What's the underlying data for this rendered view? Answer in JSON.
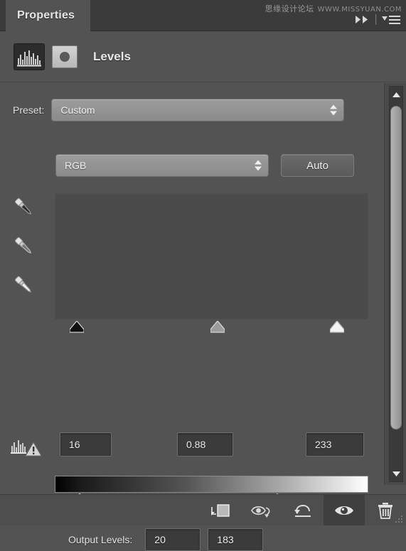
{
  "window": {
    "tab_label": "Properties",
    "watermark_cn": "思缘设计论坛",
    "watermark_url": "WWW.MISSYUAN.COM",
    "collapse_icon": "double-chevron-right-icon",
    "menu_icon": "panel-menu-icon"
  },
  "adjustment": {
    "title": "Levels",
    "type_icon": "levels-histogram-icon",
    "mask_icon": "layer-mask-thumbnail"
  },
  "preset": {
    "label": "Preset:",
    "value": "Custom",
    "stepper_icon": "stepper-arrows-icon"
  },
  "channel": {
    "value": "RGB",
    "stepper_icon": "stepper-arrows-icon",
    "auto_label": "Auto"
  },
  "eyedroppers": [
    {
      "name": "set-black-point-eyedropper",
      "tip": "black"
    },
    {
      "name": "set-gray-point-eyedropper",
      "tip": "gray"
    },
    {
      "name": "set-white-point-eyedropper",
      "tip": "white"
    }
  ],
  "input_levels": {
    "shadow": "16",
    "midtone": "0.88",
    "highlight": "233",
    "warning_icon": "histogram-refresh-warning-icon",
    "slider_positions_pct": {
      "shadow": 7,
      "midtone": 52,
      "highlight": 90
    }
  },
  "output_levels": {
    "label": "Output Levels:",
    "black": "20",
    "white": "183",
    "slider_positions_pct": {
      "black": 8,
      "white": 71
    }
  },
  "scrollbar": {
    "up_icon": "scroll-up-arrow-icon",
    "down_icon": "scroll-down-arrow-icon",
    "thumb": "scrollbar-thumb"
  },
  "toolbar": [
    {
      "name": "clip-to-layer-button",
      "icon": "clip-to-layer-icon",
      "active": false
    },
    {
      "name": "toggle-previous-state-button",
      "icon": "eye-previous-state-icon",
      "active": false
    },
    {
      "name": "reset-adjustment-button",
      "icon": "reset-arrow-icon",
      "active": false
    },
    {
      "name": "toggle-visibility-button",
      "icon": "eye-icon",
      "active": true
    },
    {
      "name": "delete-adjustment-button",
      "icon": "trash-icon",
      "active": false
    }
  ],
  "colors": {
    "panel_bg": "#535353",
    "tabbar_bg": "#3b3b3b",
    "field_bg": "#3b3b3b",
    "histogram_bg": "#4b4b4b",
    "text": "#e6e6e6"
  }
}
